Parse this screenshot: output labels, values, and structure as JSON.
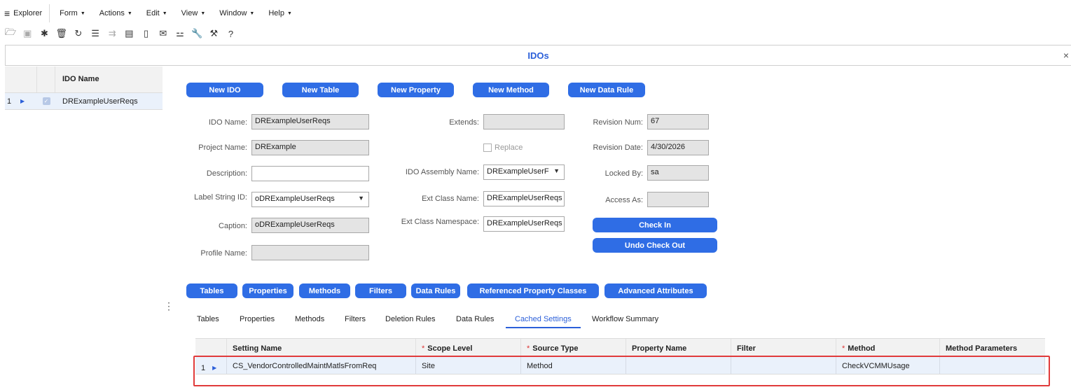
{
  "menubar": {
    "explorer": "Explorer",
    "items": [
      "Form",
      "Actions",
      "Edit",
      "View",
      "Window",
      "Help"
    ]
  },
  "toolbar": {
    "icons": [
      "open-folder-icon",
      "save-icon",
      "new-record-icon",
      "delete-icon",
      "refresh-icon",
      "filter-icon",
      "filter-in-place-icon",
      "clipboard-icon",
      "document-icon",
      "mail-icon",
      "org-chart-icon",
      "wrench-icon",
      "tools-icon",
      "help-icon"
    ]
  },
  "form": {
    "title": "IDOs",
    "close": "×"
  },
  "left_grid": {
    "header": "IDO Name",
    "rows": [
      {
        "num": "1",
        "value": "DRExampleUserReqs"
      }
    ]
  },
  "top_buttons": {
    "new_ido": "New IDO",
    "new_table": "New Table",
    "new_property": "New Property",
    "new_method": "New Method",
    "new_data_rule": "New Data Rule"
  },
  "fields": {
    "ido_name_label": "IDO Name:",
    "ido_name": "DRExampleUserReqs",
    "project_name_label": "Project Name:",
    "project_name": "DRExample",
    "description_label": "Description:",
    "description": "",
    "label_string_id_label": "Label String ID:",
    "label_string_id": "oDRExampleUserReqs",
    "caption_label": "Caption:",
    "caption": "oDRExampleUserReqs",
    "profile_name_label": "Profile Name:",
    "profile_name": "",
    "extends_label": "Extends:",
    "extends": "",
    "replace_label": "Replace",
    "assembly_label": "IDO Assembly Name:",
    "assembly": "DRExampleUserF",
    "ext_class_name_label": "Ext Class Name:",
    "ext_class_name": "DRExampleUserReqs",
    "ext_class_ns_label": "Ext Class Namespace:",
    "ext_class_ns": "DRExampleUserReqs",
    "revision_num_label": "Revision Num:",
    "revision_num": "67",
    "revision_date_label": "Revision Date:",
    "revision_date": "4/30/2026",
    "locked_by_label": "Locked By:",
    "locked_by": "sa",
    "access_as_label": "Access As:",
    "access_as": ""
  },
  "action_buttons": {
    "check_in": "Check In",
    "undo_check_out": "Undo Check Out"
  },
  "section_buttons": {
    "tables": "Tables",
    "properties": "Properties",
    "methods": "Methods",
    "filters": "Filters",
    "data_rules": "Data Rules",
    "referenced_property_classes": "Referenced Property Classes",
    "advanced_attributes": "Advanced Attributes"
  },
  "tabs": [
    "Tables",
    "Properties",
    "Methods",
    "Filters",
    "Deletion Rules",
    "Data Rules",
    "Cached Settings",
    "Workflow Summary"
  ],
  "active_tab": "Cached Settings",
  "settings_grid": {
    "headers": [
      "Setting Name",
      "Scope Level",
      "Source Type",
      "Property Name",
      "Filter",
      "Method",
      "Method Parameters"
    ],
    "rows": [
      {
        "num": "1",
        "setting_name": "CS_VendorControlledMaintMatlsFromReq",
        "scope_level": "Site",
        "source_type": "Method",
        "property_name": "",
        "filter": "",
        "method": "CheckVCMMUsage",
        "method_parameters": ""
      }
    ]
  },
  "colors": {
    "accent": "#2f6de5",
    "title": "#2b5fd9",
    "highlight_box": "#e03b3b"
  }
}
